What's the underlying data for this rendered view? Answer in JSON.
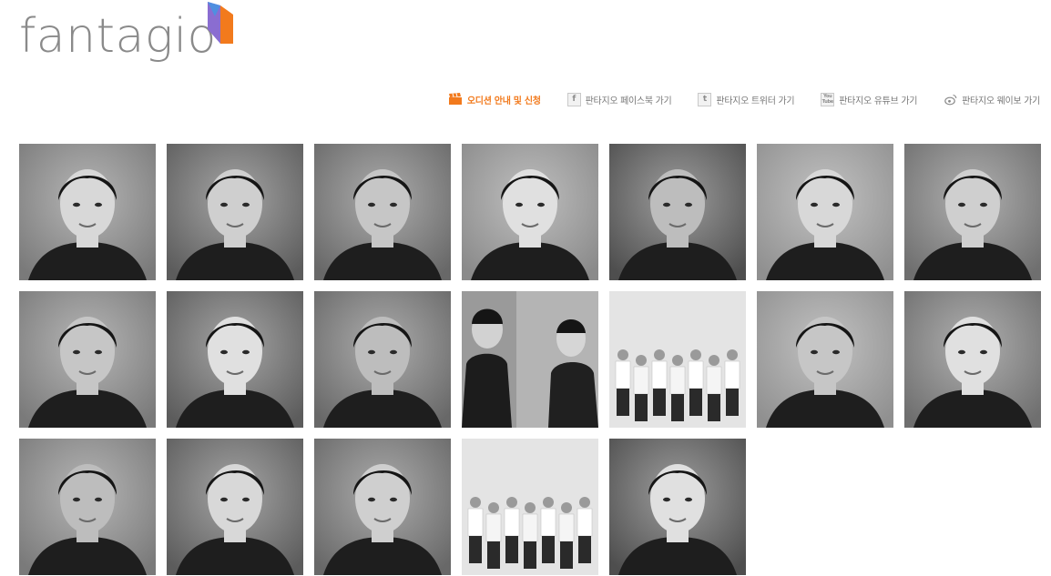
{
  "brand": {
    "logo_text": "fantagio"
  },
  "header_links": [
    {
      "label": "오디션 안내 및 신청",
      "icon": "clapperboard-icon",
      "accent": "#f27a1d"
    },
    {
      "label": "판타지오 페이스북 가기",
      "icon": "facebook-icon"
    },
    {
      "label": "판타지오 트위터 가기",
      "icon": "twitter-icon"
    },
    {
      "label": "판타지오 유튜브 가기",
      "icon": "youtube-icon"
    },
    {
      "label": "판타지오 웨이보 가기",
      "icon": "weibo-icon"
    }
  ],
  "colors": {
    "logo_text": "#8a8a8a",
    "logo_orange": "#f27a1d",
    "logo_purple": "#8a6dd1",
    "logo_blue": "#4f8fe0",
    "link_text": "#777777"
  },
  "artist_grid": {
    "count": 19,
    "tiles": [
      {
        "kind": "portrait"
      },
      {
        "kind": "portrait"
      },
      {
        "kind": "portrait"
      },
      {
        "kind": "portrait"
      },
      {
        "kind": "portrait"
      },
      {
        "kind": "portrait"
      },
      {
        "kind": "portrait"
      },
      {
        "kind": "portrait"
      },
      {
        "kind": "portrait"
      },
      {
        "kind": "portrait"
      },
      {
        "kind": "duo"
      },
      {
        "kind": "group"
      },
      {
        "kind": "portrait"
      },
      {
        "kind": "portrait"
      },
      {
        "kind": "portrait"
      },
      {
        "kind": "portrait"
      },
      {
        "kind": "portrait"
      },
      {
        "kind": "group"
      },
      {
        "kind": "portrait"
      }
    ]
  }
}
